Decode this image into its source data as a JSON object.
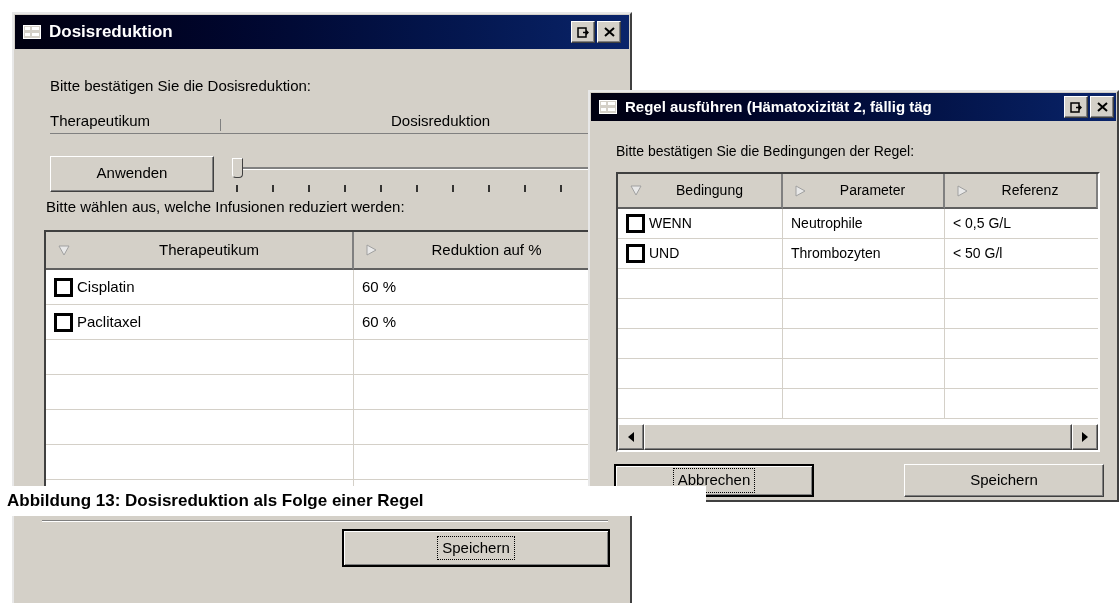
{
  "dose_window": {
    "title": "Dosisreduktion",
    "prompt": "Bitte bestätigen Sie die Dosisreduktion:",
    "header_labels": [
      "Therapeutikum",
      "Dosisreduktion"
    ],
    "apply_button": "Anwenden",
    "slider": {
      "level": 0
    },
    "list_prompt": "Bitte wählen aus, welche Infusionen reduziert werden:",
    "table": {
      "columns": [
        {
          "label": "Therapeutikum",
          "sorted": true
        },
        {
          "label": "Reduktion auf %",
          "sorted": false
        }
      ],
      "rows": [
        {
          "name": "Cisplatin",
          "checked": false,
          "value": "60 %"
        },
        {
          "name": "Paclitaxel",
          "checked": false,
          "value": "60 %"
        }
      ]
    },
    "save_button": "Speichern"
  },
  "rule_window": {
    "title": "Regel ausführen (Hämatoxizität 2, fällig täg",
    "prompt": "Bitte bestätigen Sie die Bedingungen der Regel:",
    "table": {
      "columns": [
        {
          "label": "Bedingung",
          "sorted": true
        },
        {
          "label": "Parameter",
          "sorted": false
        },
        {
          "label": "Referenz",
          "sorted": false
        }
      ],
      "rows": [
        {
          "condition": "WENN",
          "checked": false,
          "parameter": "Neutrophile",
          "reference": "< 0,5 G/L"
        },
        {
          "condition": "UND",
          "checked": false,
          "parameter": "Thrombozyten",
          "reference": "< 50 G/l"
        }
      ]
    },
    "cancel_button": "Abbrechen",
    "save_button": "Speichern"
  },
  "caption": "Abbildung 13: Dosisreduktion als Folge einer Regel"
}
